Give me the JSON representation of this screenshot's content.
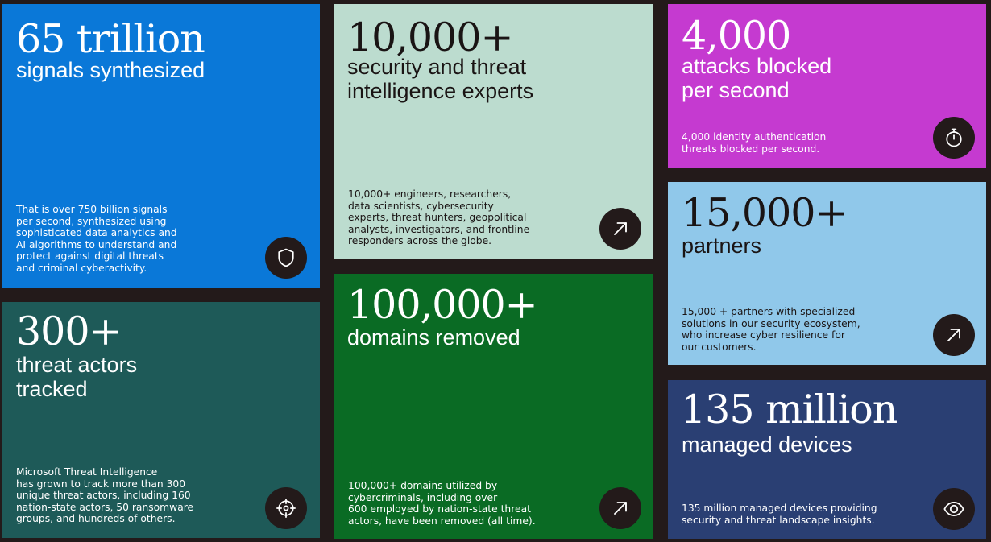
{
  "tiles": {
    "signals": {
      "stat": "65 trillion",
      "sub": [
        "signals synthesized"
      ],
      "desc": [
        "That is over 750 billion signals",
        "per second, synthesized using",
        "sophisticated data analytics and",
        "AI algorithms to understand and",
        "protect against digital threats",
        "and criminal cyberactivity."
      ],
      "icon": "shield-icon",
      "color": "#0a78d8"
    },
    "experts": {
      "stat": "10,000+",
      "sub": [
        "security and threat",
        "intelligence experts"
      ],
      "desc": [
        "10,000+ engineers, researchers,",
        "data scientists, cybersecurity",
        "experts, threat hunters, geopolitical",
        "analysts, investigators, and frontline",
        "responders across the globe."
      ],
      "icon": "arrow-up-right-icon",
      "color": "#bcdccf"
    },
    "attacks": {
      "stat": "4,000",
      "sub": [
        "attacks blocked",
        "per second"
      ],
      "desc": [
        "4,000 identity authentication",
        "threats blocked per second."
      ],
      "icon": "stopwatch-icon",
      "color": "#c53ad0"
    },
    "actors": {
      "stat": "300+",
      "sub": [
        "threat actors",
        "tracked"
      ],
      "desc": [
        "Microsoft Threat Intelligence",
        "has grown to track more than 300",
        "unique threat actors, including 160",
        "nation-state actors, 50 ransomware",
        "groups, and hundreds of others."
      ],
      "icon": "crosshair-icon",
      "color": "#1e5a58"
    },
    "domains": {
      "stat": "100,000+",
      "sub": [
        "domains removed"
      ],
      "desc": [
        "100,000+ domains utilized by",
        "cybercriminals, including over",
        "600 employed by nation-state threat",
        "actors, have been removed (all time)."
      ],
      "icon": "arrow-up-right-icon",
      "color": "#0a6b24"
    },
    "partners": {
      "stat": "15,000+",
      "sub": [
        "partners"
      ],
      "desc": [
        "15,000 + partners with specialized",
        "solutions in our security ecosystem,",
        "who increase cyber resilience for",
        "our customers."
      ],
      "icon": "arrow-up-right-icon",
      "color": "#90c8ea"
    },
    "devices": {
      "stat": "135 million",
      "sub": [
        "managed devices"
      ],
      "desc": [
        "135 million managed devices providing",
        "security and threat landscape insights."
      ],
      "icon": "eye-icon",
      "color": "#2a3f73"
    }
  }
}
